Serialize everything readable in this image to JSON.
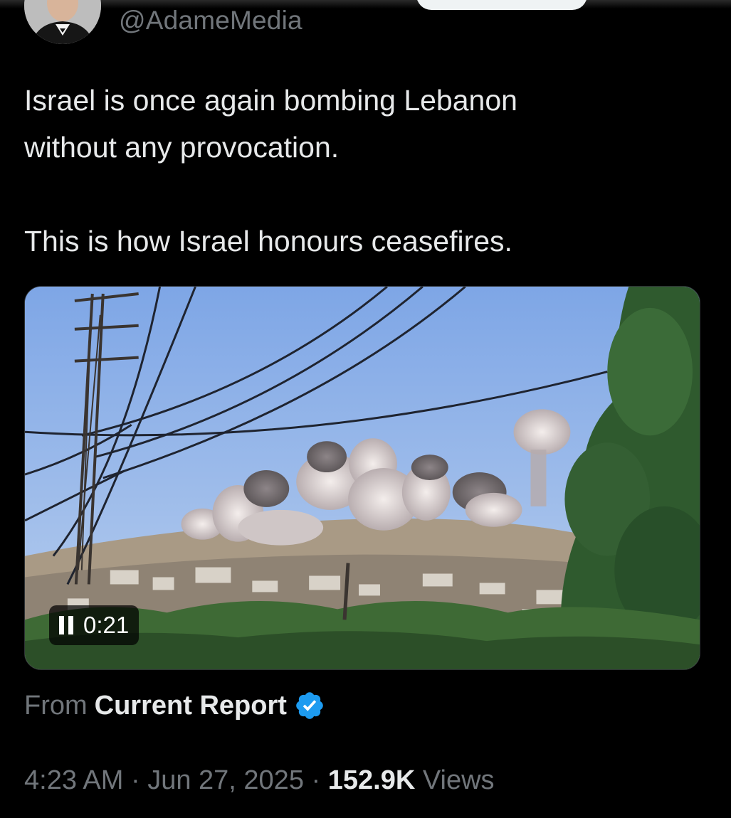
{
  "author": {
    "handle": "@AdameMedia"
  },
  "tweet": {
    "text": "Israel is once again bombing Lebanon\nwithout any provocation.\n\nThis is how Israel honours ceasefires."
  },
  "media": {
    "icon": "video-thumbnail",
    "state": "playing",
    "duration": "0:21"
  },
  "source": {
    "from_label": "From",
    "name": "Current Report",
    "verified_icon": "verified-badge-icon",
    "verified_color": "#1d9bf0"
  },
  "meta": {
    "time": "4:23 AM",
    "separator1": " · ",
    "date": "Jun 27, 2025",
    "separator2": " · ",
    "views_count": "152.9K",
    "views_label": "Views"
  },
  "colors": {
    "background": "#000000",
    "primary_text": "#e7e9ea",
    "secondary_text": "#71767b",
    "accent": "#1d9bf0"
  }
}
